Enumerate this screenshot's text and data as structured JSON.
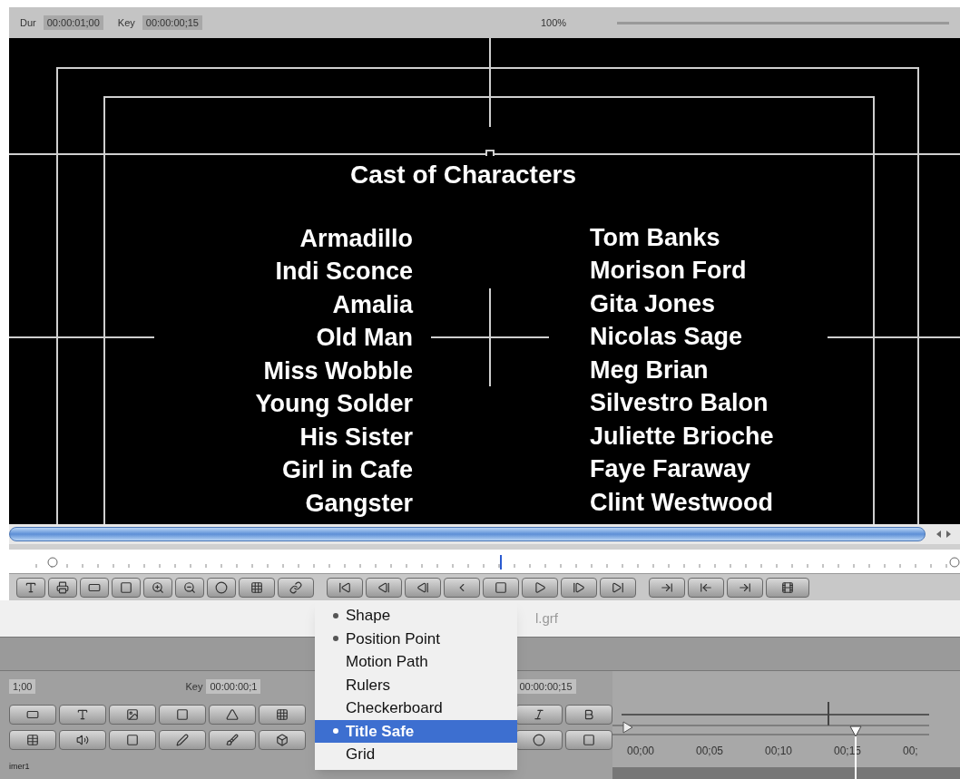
{
  "top_bar": {
    "dur_label": "Dur",
    "dur_value": "00:00:01;00",
    "key_label": "Key",
    "key_value": "00:00:00;15",
    "zoom": "100%"
  },
  "preview": {
    "heading": "Cast of Characters",
    "credits": [
      {
        "role": "Armadillo",
        "actor": "Tom Banks"
      },
      {
        "role": "Indi Sconce",
        "actor": "Morison Ford"
      },
      {
        "role": "Amalia",
        "actor": "Gita Jones"
      },
      {
        "role": "Old Man",
        "actor": "Nicolas Sage"
      },
      {
        "role": "Miss Wobble",
        "actor": "Meg Brian"
      },
      {
        "role": "Young Solder",
        "actor": "Silvestro Balon"
      },
      {
        "role": "His Sister",
        "actor": "Juliette Brioche"
      },
      {
        "role": "Girl in Cafe",
        "actor": "Faye Faraway"
      },
      {
        "role": "Gangster",
        "actor": "Clint Westwood"
      }
    ]
  },
  "file_name": "l.grf",
  "lower_panel": {
    "field_1": "1;00",
    "key_label": "Key",
    "key_value": "00:00:00;1",
    "field_3": "00:00:00;15",
    "status": "imer1"
  },
  "menu": [
    {
      "label": "Shape",
      "checked": true,
      "selected": false
    },
    {
      "label": "Position Point",
      "checked": true,
      "selected": false
    },
    {
      "label": "Motion Path",
      "checked": false,
      "selected": false
    },
    {
      "label": "Rulers",
      "checked": false,
      "selected": false
    },
    {
      "label": "Checkerboard",
      "checked": false,
      "selected": false
    },
    {
      "label": "Title Safe",
      "checked": true,
      "selected": true
    },
    {
      "label": "Grid",
      "checked": false,
      "selected": false
    }
  ],
  "timeline": {
    "labels": [
      "00;00",
      "00;05",
      "00;10",
      "00;15",
      "00;"
    ]
  }
}
